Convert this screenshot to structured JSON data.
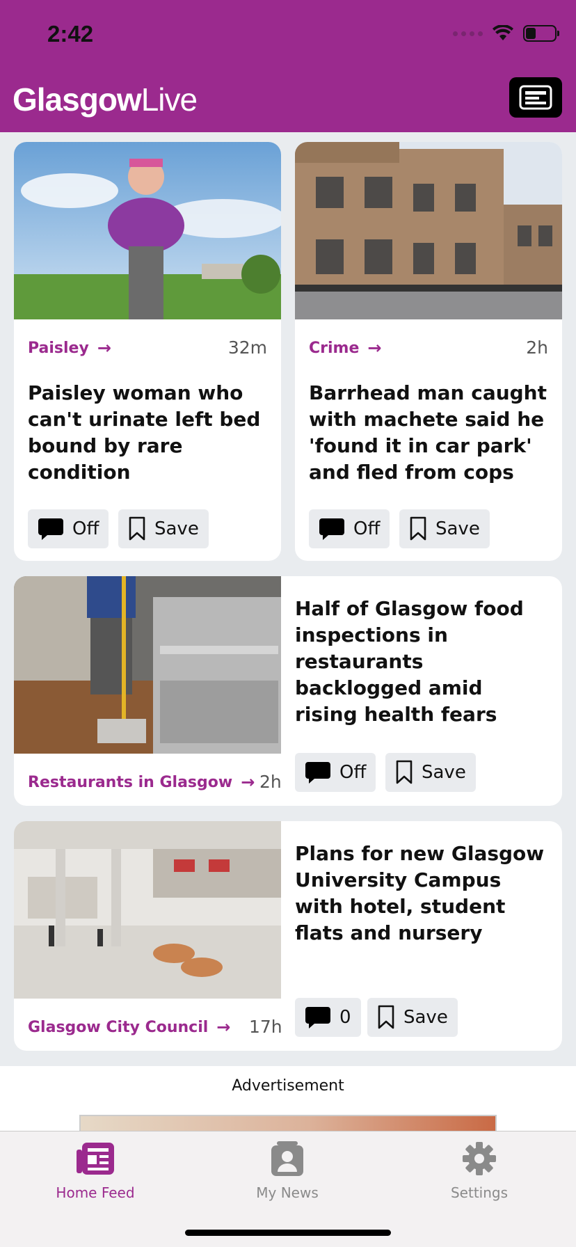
{
  "status": {
    "time": "2:42"
  },
  "app": {
    "logo_bold": "Glasgow",
    "logo_light": "Live"
  },
  "articles": [
    {
      "category": "Paisley",
      "age": "32m",
      "headline": "Paisley woman who can't urinate left bed bound by rare condition",
      "comments": "Off",
      "save": "Save"
    },
    {
      "category": "Crime",
      "age": "2h",
      "headline": "Barrhead man caught with machete said he 'found it in car park' and fled from cops",
      "comments": "Off",
      "save": "Save"
    },
    {
      "category": "Restaurants in Glasgow",
      "age": "2h",
      "headline": "Half of Glasgow food inspections in restaurants backlogged amid rising health fears",
      "comments": "Off",
      "save": "Save"
    },
    {
      "category": "Glasgow City Council",
      "age": "17h",
      "headline": "Plans for new Glasgow University Campus with hotel, student flats and nursery",
      "comments": "0",
      "save": "Save"
    }
  ],
  "ad": {
    "label": "Advertisement"
  },
  "tabs": [
    {
      "label": "Home Feed",
      "active": true
    },
    {
      "label": "My News",
      "active": false
    },
    {
      "label": "Settings",
      "active": false
    }
  ],
  "colors": {
    "brand": "#9b2a8e",
    "inactive_tab": "#8a8a8a"
  }
}
